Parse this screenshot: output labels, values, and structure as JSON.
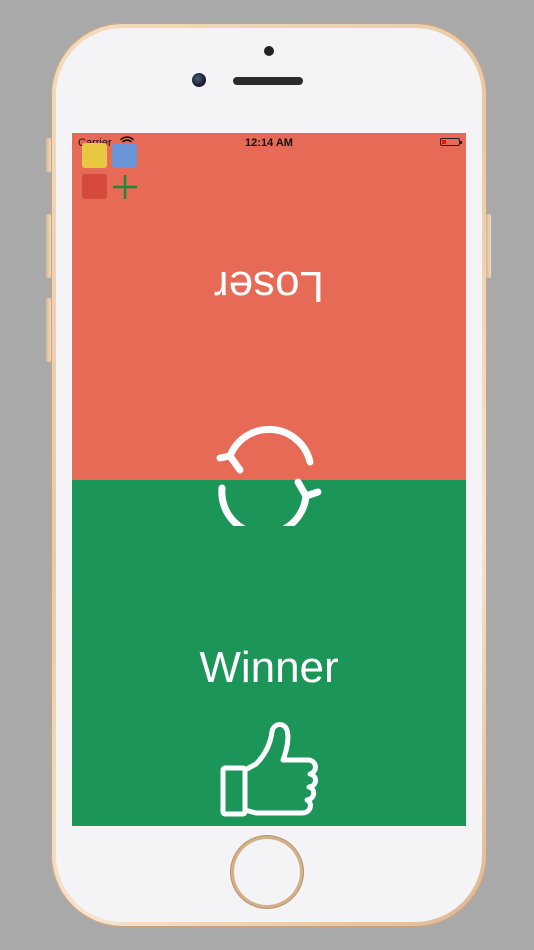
{
  "status_bar": {
    "carrier": "Carrier",
    "time": "12:14 AM"
  },
  "toolbar": {
    "swatches": [
      {
        "name": "yellow",
        "color": "#e8c840"
      },
      {
        "name": "blue",
        "color": "#6a95d6"
      },
      {
        "name": "red",
        "color": "#d44a3c"
      }
    ],
    "add_icon": "plus-icon"
  },
  "top_panel": {
    "label": "Loser",
    "color": "#e66a55"
  },
  "bottom_panel": {
    "label": "Winner",
    "color": "#1c9559"
  },
  "icons": {
    "swap": "swap-arrows-icon",
    "thumb": "thumbs-up-icon"
  }
}
